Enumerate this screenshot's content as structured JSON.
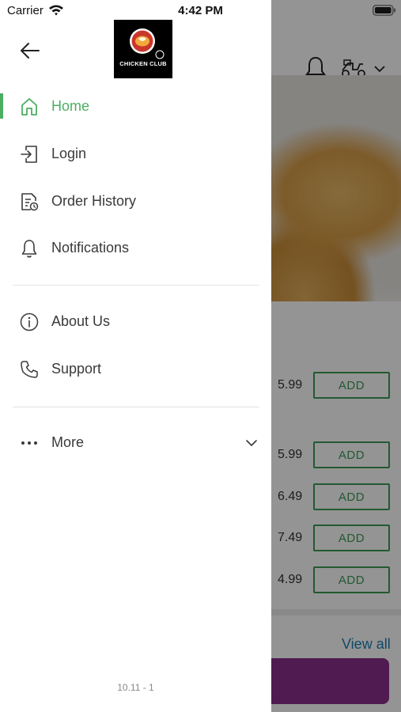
{
  "status_bar": {
    "carrier": "Carrier",
    "time": "4:42 PM",
    "wifi_icon": "wifi-icon",
    "battery_icon": "battery-icon"
  },
  "background_app": {
    "header_icons": [
      "bell-icon",
      "scooter-icon",
      "chevron-down-icon"
    ],
    "items": [
      {
        "price": "5.99",
        "add_label": "ADD"
      },
      {
        "price": "5.99",
        "add_label": "ADD"
      },
      {
        "price": "6.49",
        "add_label": "ADD"
      },
      {
        "price": "7.49",
        "add_label": "ADD"
      },
      {
        "price": "4.99",
        "add_label": "ADD"
      }
    ],
    "view_all_label": "View all",
    "accent_color": "#3d9a55",
    "link_color": "#1a7fb0",
    "cta_color": "#8b2f8a"
  },
  "drawer": {
    "back_icon": "arrow-left-icon",
    "logo_text": "CHICKEN CLUB",
    "active_color": "#4cae62",
    "menu": [
      {
        "label": "Home",
        "icon": "home-icon",
        "active": true
      },
      {
        "label": "Login",
        "icon": "login-icon",
        "active": false
      },
      {
        "label": "Order History",
        "icon": "order-history-icon",
        "active": false
      },
      {
        "label": "Notifications",
        "icon": "bell-icon",
        "active": false
      }
    ],
    "secondary_menu": [
      {
        "label": "About Us",
        "icon": "info-icon"
      },
      {
        "label": "Support",
        "icon": "phone-icon"
      }
    ],
    "more": {
      "label": "More",
      "icon": "more-dots-icon",
      "expand_icon": "chevron-down-icon"
    },
    "version": "10.11 - 1"
  }
}
